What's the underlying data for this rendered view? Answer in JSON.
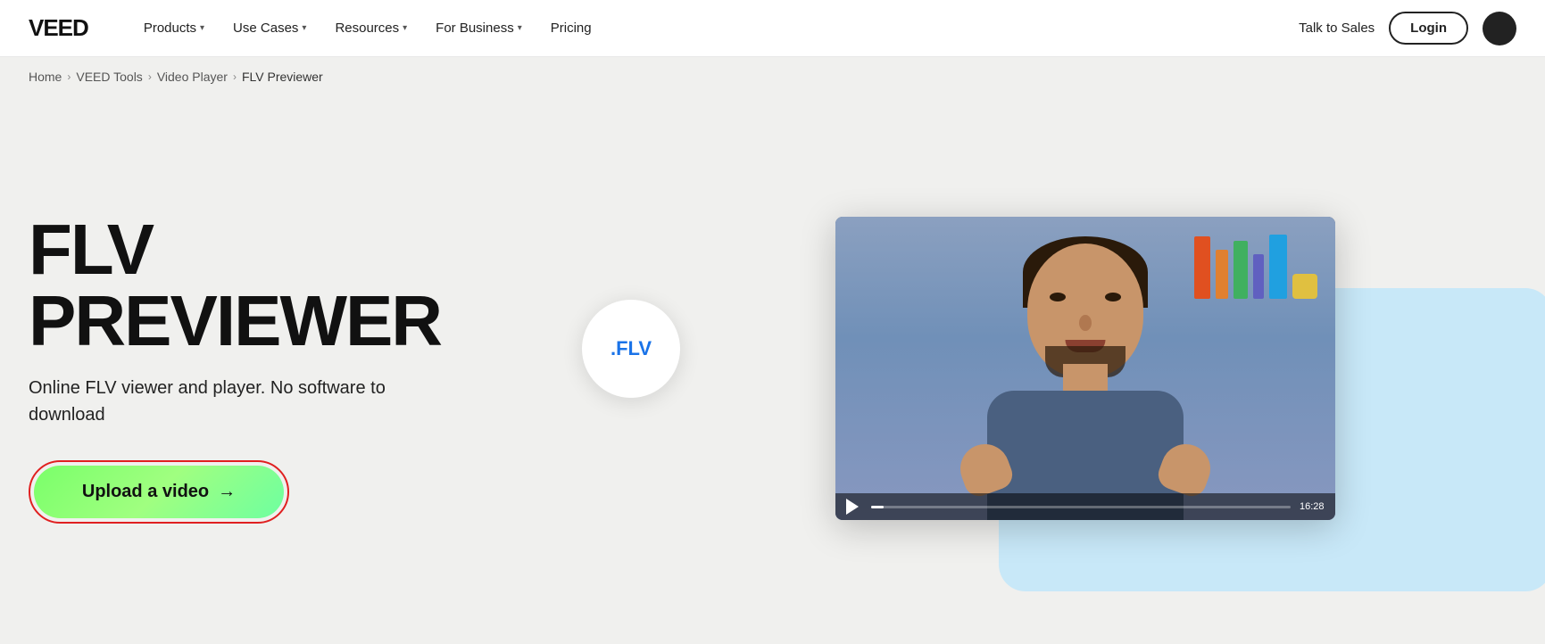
{
  "brand": {
    "logo": "VEED"
  },
  "nav": {
    "items": [
      {
        "label": "Products",
        "hasDropdown": true
      },
      {
        "label": "Use Cases",
        "hasDropdown": true
      },
      {
        "label": "Resources",
        "hasDropdown": true
      },
      {
        "label": "For Business",
        "hasDropdown": true
      },
      {
        "label": "Pricing",
        "hasDropdown": false
      }
    ],
    "talk_to_sales": "Talk to Sales",
    "login": "Login"
  },
  "breadcrumb": {
    "items": [
      {
        "label": "Home",
        "link": true
      },
      {
        "label": "VEED Tools",
        "link": true
      },
      {
        "label": "Video Player",
        "link": true
      },
      {
        "label": "FLV Previewer",
        "link": false
      }
    ]
  },
  "hero": {
    "title": "FLV PREVIEWER",
    "subtitle": "Online FLV viewer and player. No software to download",
    "upload_button": "Upload a video",
    "upload_arrow": "→",
    "flv_badge": ".FLV",
    "video_time": "16:28"
  }
}
